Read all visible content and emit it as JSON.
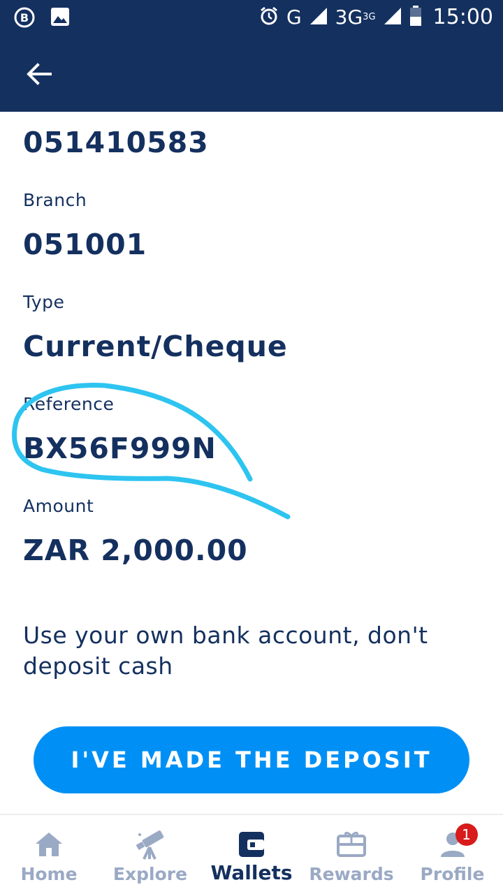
{
  "status_bar": {
    "network_g": "G",
    "network_3g": "3G",
    "network_3g_sup": "3G",
    "time": "15:00",
    "icons": [
      "b-app-icon",
      "image-icon",
      "alarm-icon",
      "signal-icon",
      "battery-icon"
    ]
  },
  "app_bar": {
    "back_icon": "arrow-left-icon"
  },
  "details": {
    "account_number": "051410583",
    "branch_label": "Branch",
    "branch_value": "051001",
    "type_label": "Type",
    "type_value": "Current/Cheque",
    "reference_label": "Reference",
    "reference_value": "BX56F999N",
    "amount_label": "Amount",
    "amount_value": "ZAR 2,000.00"
  },
  "hint": "Use your own bank account, don't deposit cash",
  "cta_label": "I'VE MADE THE DEPOSIT",
  "nav": {
    "home": "Home",
    "explore": "Explore",
    "wallets": "Wallets",
    "rewards": "Rewards",
    "profile": "Profile",
    "profile_badge": "1"
  },
  "colors": {
    "primary": "#14305f",
    "accent": "#0090f5",
    "inactive": "#9aa9c4",
    "badge": "#d81b1b",
    "annotation": "#2ec4f0"
  }
}
